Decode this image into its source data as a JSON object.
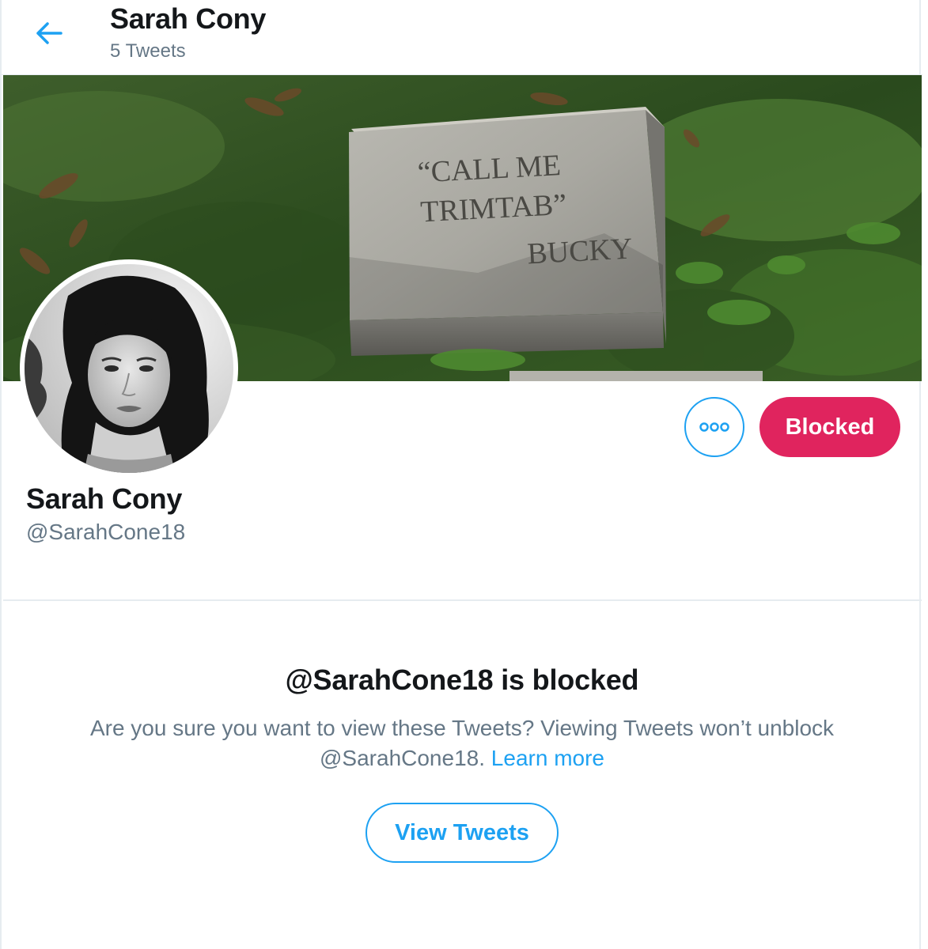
{
  "header": {
    "title": "Sarah Cony",
    "subtitle": "5 Tweets"
  },
  "banner": {
    "inscription_line1": "“CALL  ME",
    "inscription_line2": "TRIMTAB”",
    "inscription_line3": "BUCKY"
  },
  "profile": {
    "display_name": "Sarah Cony",
    "handle": "@SarahCone18"
  },
  "actions": {
    "blocked_label": "Blocked"
  },
  "notice": {
    "title": "@SarahCone18 is blocked",
    "body": "Are you sure you want to view these Tweets? Viewing Tweets won’t unblock @SarahCone18.",
    "learn_more": "Learn more",
    "view_button": "View Tweets"
  },
  "colors": {
    "accent": "#1da1f2",
    "blocked": "#e0245e",
    "secondary_text": "#657786"
  },
  "icons": {
    "back": "arrow-left-icon",
    "more": "more-dots-icon"
  }
}
